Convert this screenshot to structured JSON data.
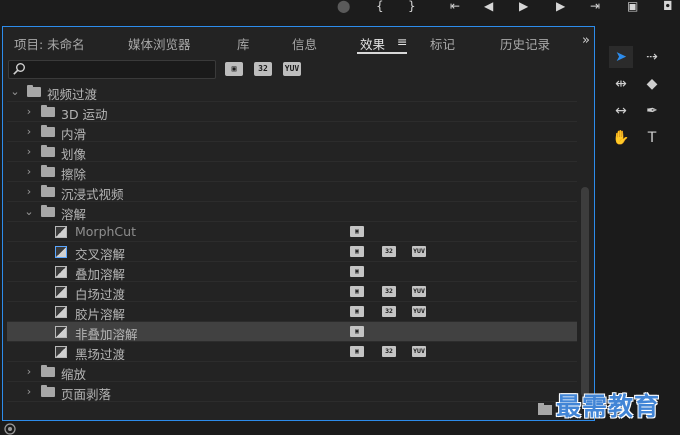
{
  "tabs": [
    {
      "label": "项目: 未命名"
    },
    {
      "label": "媒体浏览器"
    },
    {
      "label": "库"
    },
    {
      "label": "信息"
    },
    {
      "label": "效果",
      "menu_icon": "≡"
    },
    {
      "label": "标记"
    },
    {
      "label": "历史记录"
    }
  ],
  "tabs_overflow": "»",
  "search": {
    "value": "",
    "placeholder": ""
  },
  "filters": [
    {
      "label": "",
      "icon": "accelerated-effects-icon"
    },
    {
      "label": "32",
      "icon": "32bit-color-icon"
    },
    {
      "label": "YUV",
      "icon": "yuv-effects-icon"
    }
  ],
  "tree": [
    {
      "label": "视频过渡",
      "type": "folder",
      "level": 0,
      "expanded": true
    },
    {
      "label": "3D 运动",
      "type": "folder",
      "level": 1,
      "expanded": false
    },
    {
      "label": "内滑",
      "type": "folder",
      "level": 1,
      "expanded": false
    },
    {
      "label": "划像",
      "type": "folder",
      "level": 1,
      "expanded": false
    },
    {
      "label": "擦除",
      "type": "folder",
      "level": 1,
      "expanded": false
    },
    {
      "label": "沉浸式视频",
      "type": "folder",
      "level": 1,
      "expanded": false
    },
    {
      "label": "溶解",
      "type": "folder",
      "level": 1,
      "expanded": true
    },
    {
      "label": "MorphCut",
      "type": "effect",
      "level": 2,
      "badges": [
        "accel"
      ]
    },
    {
      "label": "交叉溶解",
      "type": "effect",
      "level": 2,
      "badges": [
        "accel",
        "32",
        "YUV"
      ],
      "highlight_icon": true
    },
    {
      "label": "叠加溶解",
      "type": "effect",
      "level": 2,
      "badges": [
        "accel"
      ]
    },
    {
      "label": "白场过渡",
      "type": "effect",
      "level": 2,
      "badges": [
        "accel",
        "32",
        "YUV"
      ]
    },
    {
      "label": "胶片溶解",
      "type": "effect",
      "level": 2,
      "badges": [
        "accel",
        "32",
        "YUV"
      ]
    },
    {
      "label": "非叠加溶解",
      "type": "effect",
      "level": 2,
      "badges": [
        "accel"
      ],
      "selected": true
    },
    {
      "label": "黑场过渡",
      "type": "effect",
      "level": 2,
      "badges": [
        "accel",
        "32",
        "YUV"
      ]
    },
    {
      "label": "缩放",
      "type": "folder",
      "level": 1,
      "expanded": false
    },
    {
      "label": "页面剥落",
      "type": "folder",
      "level": 1,
      "expanded": false
    }
  ],
  "tools": [
    {
      "name": "selection-tool-icon",
      "glyph": "➤",
      "active": true
    },
    {
      "name": "track-select-tool-icon",
      "glyph": "⇢"
    },
    {
      "name": "ripple-edit-tool-icon",
      "glyph": "⇹"
    },
    {
      "name": "razor-tool-icon",
      "glyph": "◆"
    },
    {
      "name": "slip-tool-icon",
      "glyph": "↔"
    },
    {
      "name": "pen-tool-icon",
      "glyph": "✒"
    },
    {
      "name": "hand-tool-icon",
      "glyph": "✋"
    },
    {
      "name": "type-tool-icon",
      "glyph": "T"
    }
  ],
  "watermark": "最需教育",
  "colors": {
    "accent": "#2d8ceb",
    "panel": "#232323",
    "selected_row": "#414141"
  }
}
